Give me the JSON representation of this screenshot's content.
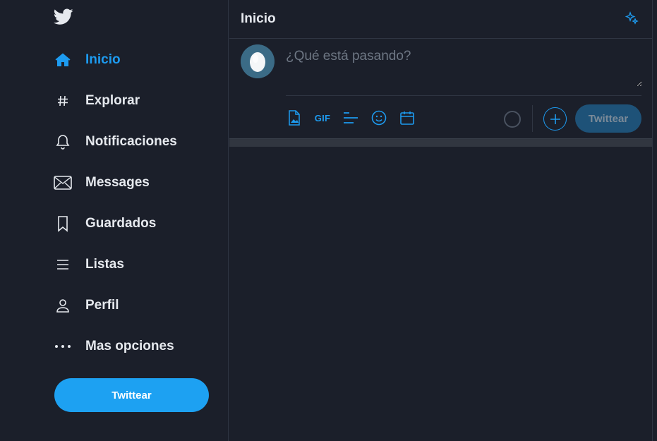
{
  "sidebar": {
    "logo": "twitter-bird-icon",
    "items": [
      {
        "label": "Inicio",
        "icon": "home-icon",
        "active": true
      },
      {
        "label": "Explorar",
        "icon": "hashtag-icon"
      },
      {
        "label": "Notificaciones",
        "icon": "bell-icon"
      },
      {
        "label": "Messages",
        "icon": "envelope-icon"
      },
      {
        "label": "Guardados",
        "icon": "bookmark-icon"
      },
      {
        "label": "Listas",
        "icon": "list-icon"
      },
      {
        "label": "Perfil",
        "icon": "person-icon"
      },
      {
        "label": "Mas opciones",
        "icon": "more-dots-icon"
      }
    ],
    "tweet_label": "Twittear"
  },
  "main": {
    "title": "Inicio",
    "composer": {
      "placeholder": "¿Qué está pasando?",
      "gif_label": "GIF",
      "submit_label": "Twittear"
    }
  },
  "colors": {
    "background": "#1b1f2a",
    "accent": "#1d9bf0",
    "button": "#1da1f2",
    "submit_disabled": "#1e5278"
  }
}
